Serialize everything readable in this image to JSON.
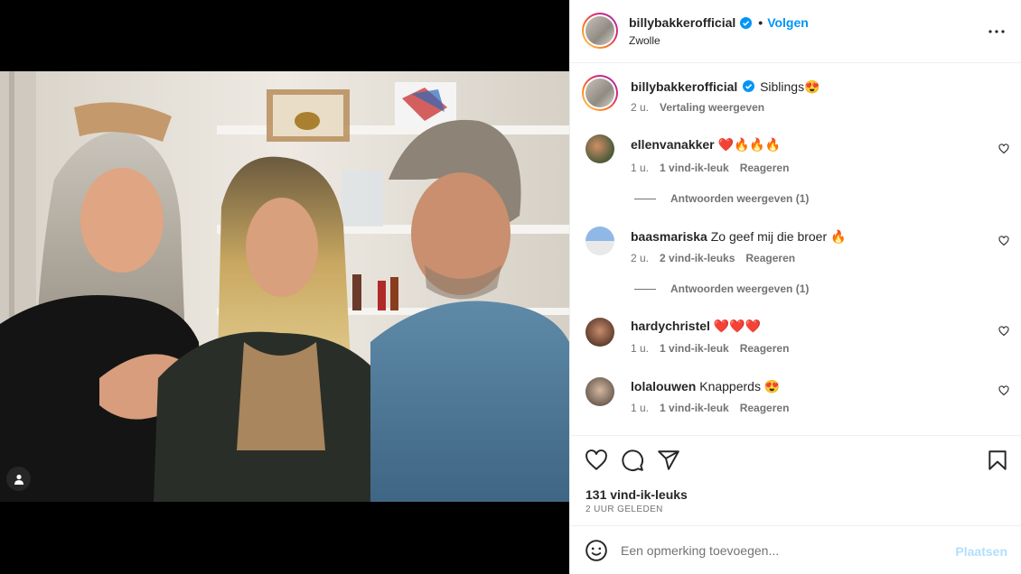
{
  "post": {
    "username": "billybakkerofficial",
    "follow_label": "Volgen",
    "location": "Zwolle",
    "separator": "•"
  },
  "caption": {
    "username": "billybakkerofficial",
    "text": "Siblings😍",
    "age": "2 u.",
    "translate_label": "Vertaling weergeven"
  },
  "comments": [
    {
      "username": "ellenvanakker",
      "text": "❤️🔥🔥🔥",
      "age": "1 u.",
      "likes": "1 vind-ik-leuk",
      "reply_label": "Reageren",
      "view_replies": "Antwoorden weergeven (1)"
    },
    {
      "username": "baasmariska",
      "text": "Zo geef mij die broer 🔥",
      "age": "2 u.",
      "likes": "2 vind-ik-leuks",
      "reply_label": "Reageren",
      "view_replies": "Antwoorden weergeven (1)"
    },
    {
      "username": "hardychristel",
      "text": "❤️❤️❤️",
      "age": "1 u.",
      "likes": "1 vind-ik-leuk",
      "reply_label": "Reageren",
      "view_replies": ""
    },
    {
      "username": "lolalouwen",
      "text": "Knapperds 😍",
      "age": "1 u.",
      "likes": "1 vind-ik-leuk",
      "reply_label": "Reageren",
      "view_replies": ""
    }
  ],
  "stats": {
    "likes": "131 vind-ik-leuks",
    "posted": "2 uur geleden"
  },
  "composer": {
    "placeholder": "Een opmerking toevoegen...",
    "post_label": "Plaatsen"
  },
  "icons": {
    "verified": "verified-badge-icon",
    "more": "more-options-icon",
    "like": "heart-icon",
    "comment": "comment-icon",
    "share": "share-icon",
    "save": "bookmark-icon",
    "emoji": "emoji-icon",
    "tag": "user-tag-icon"
  },
  "colors": {
    "accent": "#0095f6",
    "post_disabled": "#b2dffc",
    "muted": "#737373"
  }
}
